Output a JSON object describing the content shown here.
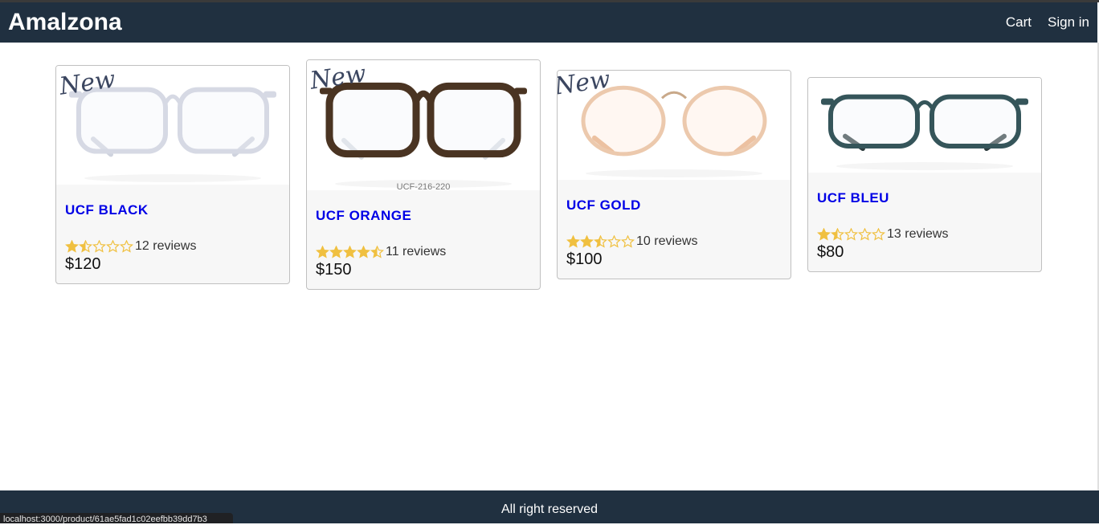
{
  "header": {
    "brand": "Amalzona",
    "nav": [
      {
        "label": "Cart"
      },
      {
        "label": "Sign in"
      }
    ]
  },
  "badge": "New",
  "products": [
    {
      "name": "UCF BLACK",
      "rating": 1.5,
      "reviews_label": "12 reviews",
      "price": "$120",
      "frame": "clear",
      "new": true,
      "code": ""
    },
    {
      "name": "UCF ORANGE",
      "rating": 4.5,
      "reviews_label": "11 reviews",
      "price": "$150",
      "frame": "tortoise",
      "new": true,
      "code": "UCF-216-220"
    },
    {
      "name": "UCF GOLD",
      "rating": 2.5,
      "reviews_label": "10 reviews",
      "price": "$100",
      "frame": "peach",
      "new": true,
      "code": ""
    },
    {
      "name": "UCF BLEU",
      "rating": 1.5,
      "reviews_label": "13 reviews",
      "price": "$80",
      "frame": "teal",
      "new": false,
      "code": ""
    }
  ],
  "footer": {
    "text": "All right reserved"
  },
  "status_bar": {
    "url": "localhost:3000/product/61ae5fad1c02eefbb39dd7b3"
  },
  "colors": {
    "header_bg": "#203040",
    "title_link": "#0000e6",
    "star": "#f0c040"
  }
}
